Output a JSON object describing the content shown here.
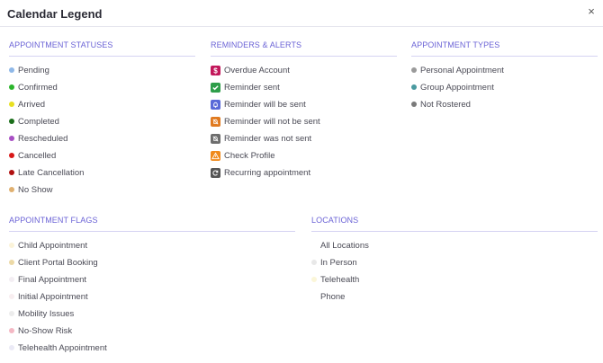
{
  "dialog": {
    "title": "Calendar Legend",
    "close_glyph": "×"
  },
  "statuses": {
    "title": "APPOINTMENT STATUSES",
    "items": [
      {
        "label": "Pending",
        "color": "#8fb8e8"
      },
      {
        "label": "Confirmed",
        "color": "#2bb52b"
      },
      {
        "label": "Arrived",
        "color": "#e8e020"
      },
      {
        "label": "Completed",
        "color": "#1a6e1a"
      },
      {
        "label": "Rescheduled",
        "color": "#a84fc4"
      },
      {
        "label": "Cancelled",
        "color": "#d81818"
      },
      {
        "label": "Late Cancellation",
        "color": "#b01010"
      },
      {
        "label": "No Show",
        "color": "#e0b070"
      }
    ]
  },
  "reminders": {
    "title": "REMINDERS & ALERTS",
    "items": [
      {
        "label": "Overdue Account",
        "icon": "dollar-icon",
        "color": "#c2185b"
      },
      {
        "label": "Reminder sent",
        "icon": "reminder-sent-icon",
        "color": "#2e9e4a"
      },
      {
        "label": "Reminder will be sent",
        "icon": "bell-icon",
        "color": "#5a6ad8"
      },
      {
        "label": "Reminder will not be sent",
        "icon": "bell-off-icon",
        "color": "#e07a20"
      },
      {
        "label": "Reminder was not sent",
        "icon": "bell-failed-icon",
        "color": "#6d6d6d"
      },
      {
        "label": "Check Profile",
        "icon": "warning-icon",
        "color": "#f08a1c"
      },
      {
        "label": "Recurring appointment",
        "icon": "recurring-icon",
        "color": "#555555"
      }
    ]
  },
  "types": {
    "title": "APPOINTMENT TYPES",
    "items": [
      {
        "label": "Personal Appointment",
        "color": "#9a9a9a"
      },
      {
        "label": "Group Appointment",
        "color": "#4a9aa0"
      },
      {
        "label": "Not Rostered",
        "color": "#7a7a7a"
      }
    ]
  },
  "flags": {
    "title": "APPOINTMENT FLAGS",
    "items": [
      {
        "label": "Child Appointment",
        "color": "#fbf3d9"
      },
      {
        "label": "Client Portal Booking",
        "color": "#ecd9a6"
      },
      {
        "label": "Final Appointment",
        "color": "#f3eef3"
      },
      {
        "label": "Initial Appointment",
        "color": "#f8eef0"
      },
      {
        "label": "Mobility Issues",
        "color": "#ececec"
      },
      {
        "label": "No-Show Risk",
        "color": "#f4b8c4"
      },
      {
        "label": "Telehealth Appointment",
        "color": "#ebeaf6"
      }
    ]
  },
  "locations": {
    "title": "LOCATIONS",
    "items": [
      {
        "label": "All Locations",
        "color": "#ffffff"
      },
      {
        "label": "In Person",
        "color": "#e8e8e8"
      },
      {
        "label": "Telehealth",
        "color": "#fbf6d8"
      },
      {
        "label": "Phone",
        "color": "#ffffff"
      }
    ]
  }
}
